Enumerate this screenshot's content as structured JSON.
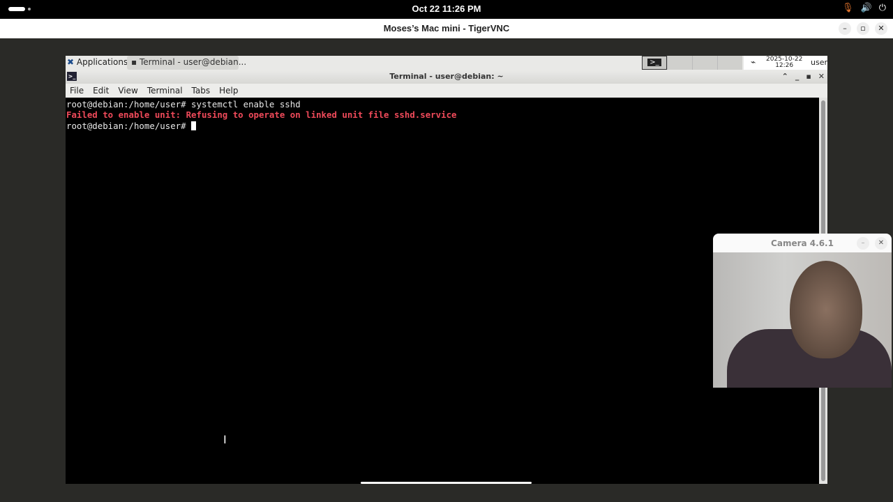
{
  "topbar": {
    "clock": "Oct 22  11:26 PM",
    "icons": [
      "microphone-icon",
      "volume-icon",
      "power-icon"
    ]
  },
  "vnc": {
    "title": "Moses’s Mac mini - TigerVNC"
  },
  "panel": {
    "applications": "Applications",
    "task": "Terminal - user@debian...",
    "tray_date": "2025-10-22",
    "tray_time": "12:26",
    "user": "user"
  },
  "terminal": {
    "title": "Terminal - user@debian: ~",
    "menu": [
      "File",
      "Edit",
      "View",
      "Terminal",
      "Tabs",
      "Help"
    ],
    "lines": [
      "root@debian:/home/user# systemctl enable sshd",
      "Failed to enable unit: Refusing to operate on linked unit file sshd.service",
      "root@debian:/home/user# "
    ]
  },
  "camera": {
    "title": "Camera 4.6.1"
  },
  "colors": {
    "error": "#ef4a5a"
  }
}
